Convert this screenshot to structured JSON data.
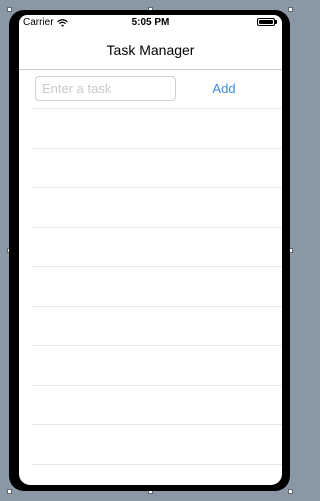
{
  "status_bar": {
    "carrier": "Carrier",
    "time": "5:05 PM",
    "battery_level": 1.0
  },
  "nav_bar": {
    "title": "Task Manager"
  },
  "task_input": {
    "placeholder": "Enter a task",
    "value": ""
  },
  "add_button": {
    "label": "Add",
    "color": "#3a8ee6"
  },
  "task_list": {
    "items": [],
    "empty_row_count": 10
  },
  "colors": {
    "canvas_background": "#8a97a5",
    "device_frame": "#000000",
    "screen_background": "#ffffff",
    "separator": "#e6e6e6"
  },
  "icons": {
    "wifi": "wifi-icon",
    "battery": "battery-icon"
  }
}
